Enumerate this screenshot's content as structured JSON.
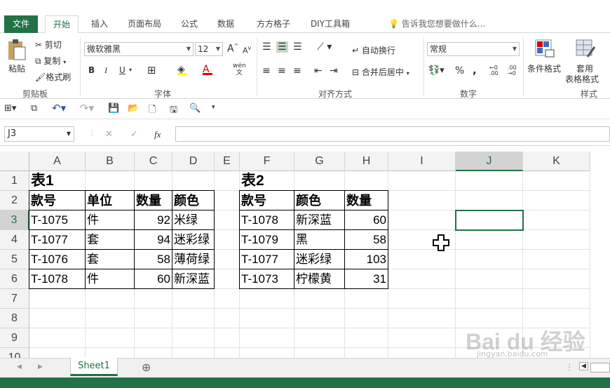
{
  "tabs": {
    "file": "文件",
    "home": "开始",
    "insert": "插入",
    "layout": "页面布局",
    "formula": "公式",
    "data": "数据",
    "fangfang": "方方格子",
    "diy": "DIY工具箱",
    "tell_me": "告诉我您想要做什么..."
  },
  "ribbon": {
    "clipboard": {
      "paste": "粘贴",
      "cut": "剪切",
      "copy": "复制",
      "format_painter": "格式刷",
      "label": "剪贴板"
    },
    "font": {
      "name": "微软雅黑",
      "size": "12",
      "bold": "B",
      "italic": "I",
      "underline": "U",
      "label": "字体",
      "grow": "A",
      "shrink": "A",
      "wen": "wén"
    },
    "align": {
      "wrap": "自动换行",
      "merge": "合并后居中",
      "label": "对齐方式"
    },
    "number": {
      "format": "常规",
      "percent": "%",
      "comma": ",",
      "label": "数字"
    },
    "styles": {
      "conditional": "条件格式",
      "table_line1": "套用",
      "table_line2": "表格格式",
      "label": "样式"
    }
  },
  "formula_bar": {
    "name_box": "J3",
    "fx": "fx",
    "content": ""
  },
  "grid": {
    "columns": [
      "A",
      "B",
      "C",
      "D",
      "E",
      "F",
      "G",
      "H",
      "I",
      "J",
      "K"
    ],
    "rows": [
      "1",
      "2",
      "3",
      "4",
      "5",
      "6",
      "7",
      "8",
      "9",
      "10"
    ],
    "selected_col": "J",
    "selected_row": "3",
    "table1": {
      "title": "表1",
      "headers": [
        "款号",
        "单位",
        "数量",
        "颜色"
      ],
      "rows": [
        [
          "T-1075",
          "件",
          "92",
          "米绿"
        ],
        [
          "T-1077",
          "套",
          "94",
          "迷彩绿"
        ],
        [
          "T-1076",
          "套",
          "58",
          "薄荷绿"
        ],
        [
          "T-1078",
          "件",
          "60",
          "新深蓝"
        ]
      ]
    },
    "table2": {
      "title": "表2",
      "headers": [
        "款号",
        "颜色",
        "数量"
      ],
      "rows": [
        [
          "T-1078",
          "新深蓝",
          "60"
        ],
        [
          "T-1079",
          "黑",
          "58"
        ],
        [
          "T-1077",
          "迷彩绿",
          "103"
        ],
        [
          "T-1073",
          "柠檬黄",
          "31"
        ]
      ]
    }
  },
  "sheets": {
    "active": "Sheet1"
  },
  "watermark": {
    "brand": "Bai du 经验",
    "url": "jingyan.baidu.com"
  },
  "colors": {
    "accent": "#217346"
  }
}
